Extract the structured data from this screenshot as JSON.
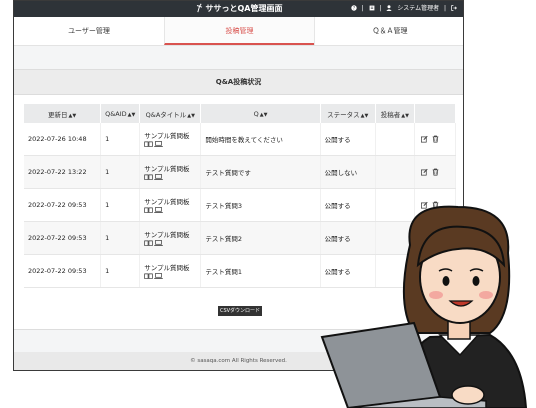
{
  "app": {
    "title": "ササっとQA管理画面",
    "user_label": "システム管理者"
  },
  "tabs": [
    {
      "label": "ユーザー管理",
      "active": false
    },
    {
      "label": "投稿管理",
      "active": true
    },
    {
      "label": "Ｑ＆Ａ管理",
      "active": false
    }
  ],
  "panel": {
    "title": "Q&A投稿状況",
    "columns": [
      "更新日",
      "Q&AID",
      "Q&Aタイトル",
      "Q",
      "ステータス",
      "投稿者",
      ""
    ],
    "rows": [
      {
        "date": "2022-07-26 10:48",
        "id": "1",
        "title": "サンプル質問板",
        "q": "開始時間を教えてください",
        "status": "公開する",
        "author": ""
      },
      {
        "date": "2022-07-22 13:22",
        "id": "1",
        "title": "サンプル質問板",
        "q": "テスト質問です",
        "status": "公開しない",
        "author": ""
      },
      {
        "date": "2022-07-22 09:53",
        "id": "1",
        "title": "サンプル質問板",
        "q": "テスト質問3",
        "status": "公開する",
        "author": ""
      },
      {
        "date": "2022-07-22 09:53",
        "id": "1",
        "title": "サンプル質問板",
        "q": "テスト質問2",
        "status": "公開する",
        "author": ""
      },
      {
        "date": "2022-07-22 09:53",
        "id": "1",
        "title": "サンプル質問板",
        "q": "テスト質問1",
        "status": "公開する",
        "author": ""
      }
    ],
    "csv_button": "CSVダウンロード"
  },
  "footer": "© sasaqa.com All Rights Reserved.",
  "colors": {
    "accent": "#d9534f",
    "topbar": "#2e3338"
  }
}
